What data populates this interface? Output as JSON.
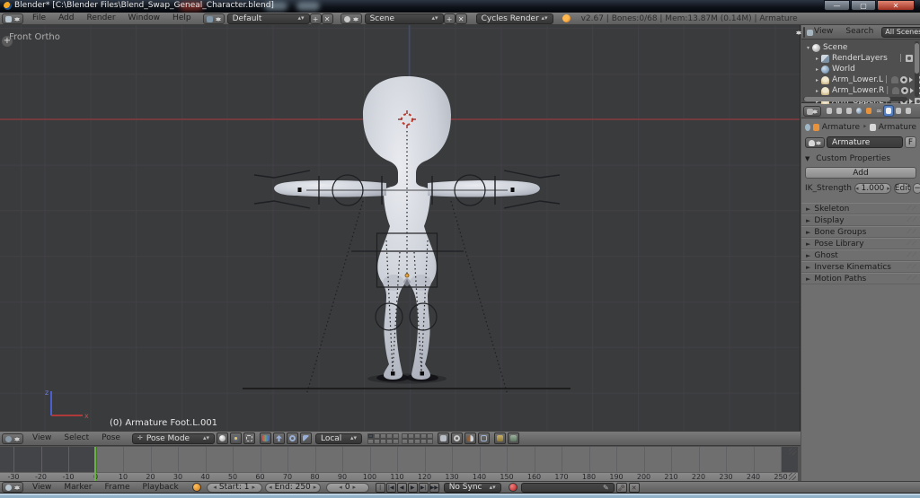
{
  "colors": {
    "select_blue": "#5680c2",
    "axis_red": "#7d3b3e",
    "axis_blue": "#3f4c74",
    "frame_green": "#64b53a",
    "body_gray": "#ccd0d8"
  },
  "window": {
    "title": "Blender* [C:\\Blender Files\\Blend_Swap_Geneal_Character.blend]",
    "minimize_glyph": "—",
    "maximize_glyph": "▢",
    "close_glyph": "✕"
  },
  "info_bar": {
    "menus": [
      "File",
      "Add",
      "Render",
      "Window",
      "Help"
    ],
    "layout_value": "Default",
    "scene_value": "Scene",
    "add_glyph": "+",
    "close_glyph": "✕",
    "engine_value": "Cycles Render",
    "stats": "v2.67 | Bones:0/68  | Mem:13.87M (0.14M) | Armature"
  },
  "viewport": {
    "view_label": "Front Ortho",
    "active_object_label": "(0) Armature Foot.L.001",
    "plus_handle": "+",
    "gizmo_x_label": "x",
    "gizmo_z_label": "z"
  },
  "view3d_header": {
    "menus": [
      "View",
      "Select",
      "Pose"
    ],
    "mode_value": "Pose Mode",
    "orientation_value": "Local"
  },
  "outliner": {
    "menus": [
      "View",
      "Search"
    ],
    "filter_value": "All Scenes",
    "rows": [
      {
        "label": "Scene",
        "icon": "scene",
        "indent": 0,
        "right": []
      },
      {
        "label": "RenderLayers",
        "icon": "renderlayers",
        "indent": 1,
        "right": [
          "camera"
        ]
      },
      {
        "label": "World",
        "icon": "world",
        "indent": 1,
        "right": []
      },
      {
        "label": "Arm_Lower.L",
        "icon": "armature",
        "indent": 1,
        "right": [
          "ghost",
          "eye",
          "pointer",
          "camera"
        ]
      },
      {
        "label": "Arm_Lower.R",
        "icon": "armature",
        "indent": 1,
        "right": [
          "ghost",
          "eye",
          "pointer",
          "camera"
        ]
      },
      {
        "label": "Arm_Upper.L",
        "icon": "armature",
        "indent": 1,
        "right": [
          "ghost",
          "eye",
          "pointer",
          "camera"
        ]
      }
    ]
  },
  "properties": {
    "tabs": [
      {
        "name": "render"
      },
      {
        "name": "render-layers"
      },
      {
        "name": "scene"
      },
      {
        "name": "world"
      },
      {
        "name": "object"
      },
      {
        "name": "constraints"
      },
      {
        "name": "armature-data",
        "active": true
      },
      {
        "name": "physics"
      },
      {
        "name": "extras"
      }
    ],
    "breadcrumb": {
      "object": "Armature",
      "separator": "‣",
      "data": "Armature"
    },
    "name_field_value": "Armature",
    "fake_user_label": "F",
    "custom_properties": {
      "title": "Custom Properties",
      "collapse_glyph": "▼",
      "add_label": "Add",
      "property_label": "IK_Strength",
      "property_value": "1.000",
      "edit_label": "Edit",
      "remove_glyph": "−"
    },
    "sections": [
      "Skeleton",
      "Display",
      "Bone Groups",
      "Pose Library",
      "Ghost",
      "Inverse Kinematics",
      "Motion Paths"
    ],
    "section_glyph": "►"
  },
  "timeline": {
    "ticks": [
      -30,
      -20,
      -10,
      0,
      10,
      20,
      30,
      40,
      50,
      60,
      70,
      80,
      90,
      100,
      110,
      120,
      130,
      140,
      150,
      160,
      170,
      180,
      190,
      200,
      210,
      220,
      230,
      240,
      250
    ],
    "current_frame": 0,
    "menus": [
      "View",
      "Marker",
      "Frame",
      "Playback"
    ],
    "start_value": "Start: 1",
    "end_value": "End: 250",
    "frame_value": "0",
    "sync_value": "No Sync",
    "playback_buttons": [
      {
        "name": "jump-to-start",
        "glyph": "|◀◀"
      },
      {
        "name": "jump-to-prev-keyframe",
        "glyph": "|◀"
      },
      {
        "name": "play-reverse",
        "glyph": "◀"
      },
      {
        "name": "play",
        "glyph": "▶"
      },
      {
        "name": "jump-to-next-keyframe",
        "glyph": "▶|"
      },
      {
        "name": "jump-to-end",
        "glyph": "▶▶|"
      }
    ]
  }
}
